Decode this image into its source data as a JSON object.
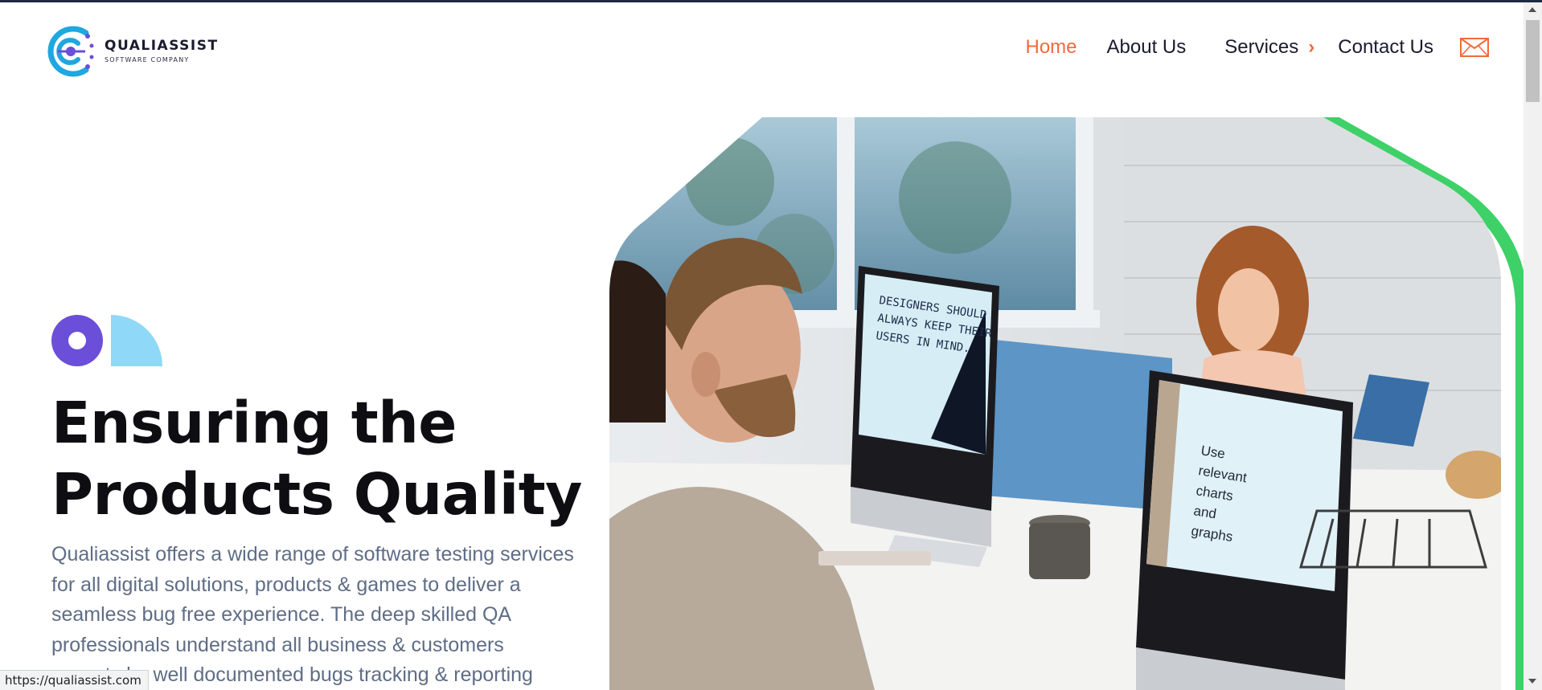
{
  "brand": {
    "name": "QUALIASSIST",
    "tagline": "SOFTWARE COMPANY",
    "colors": {
      "primary_cyan": "#1ea7e0",
      "accent_purple": "#6b4fd8",
      "nav_active": "#f26a3b",
      "image_accent_green": "#3ed168"
    }
  },
  "nav": {
    "items": [
      {
        "label": "Home",
        "active": true
      },
      {
        "label": "About Us",
        "active": false
      },
      {
        "label": "Services",
        "active": false,
        "icon": "chevron-right-icon"
      },
      {
        "label": "Contact Us",
        "active": false
      }
    ],
    "mail_icon": "envelope-icon"
  },
  "hero": {
    "title_line1": "Ensuring the",
    "title_line2": "Products Quality",
    "description": "Qualiassist offers a wide range of software testing services for all digital solutions, products & games to deliver a seamless bug free experience. The deep skilled QA professionals understand all business & customers aspects by well documented bugs tracking & reporting",
    "image": {
      "monitor_left_text": "DESIGNERS SHOULD ALWAYS KEEP THEIR USERS IN MIND.",
      "monitor_right_text": "Use relevant charts and graphs"
    }
  },
  "status_bar": {
    "url": "https://qualiassist.com"
  }
}
